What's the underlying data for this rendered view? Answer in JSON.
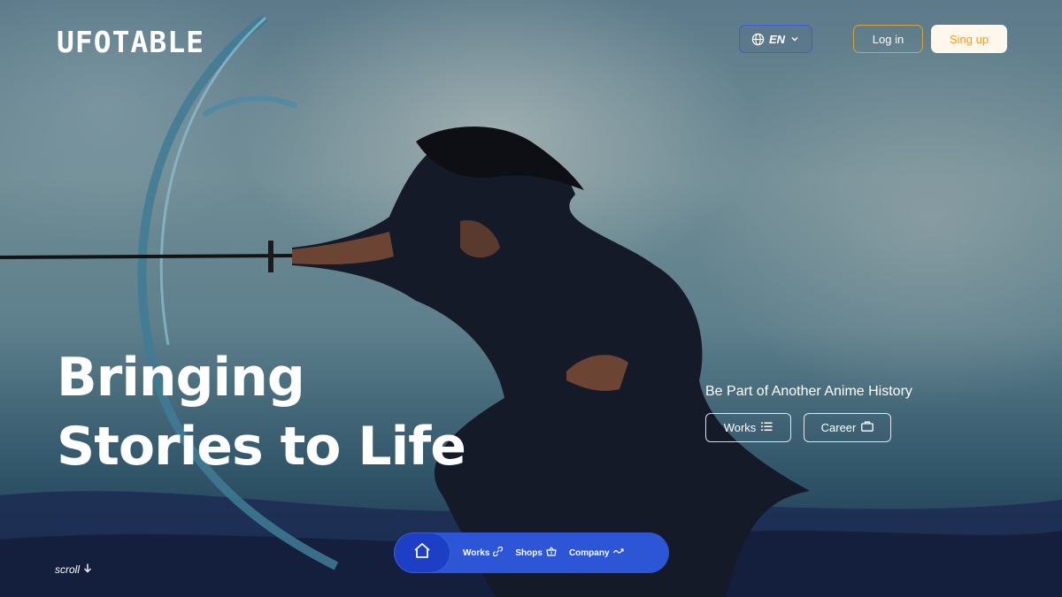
{
  "brand": {
    "logo": "UFOTABLE"
  },
  "header": {
    "language": "EN",
    "login_label": "Log in",
    "signup_label": "Sing up"
  },
  "hero": {
    "headline_line1": "Bringing",
    "headline_line2": "Stories to Life",
    "tagline": "Be Part of Another Anime History",
    "works_label": "Works",
    "career_label": "Career"
  },
  "scroll_label": "scroll",
  "bottom_nav": {
    "items": [
      {
        "label": "Works",
        "icon": "link-icon"
      },
      {
        "label": "Shops",
        "icon": "basket-icon"
      },
      {
        "label": "Company",
        "icon": "wave-icon"
      }
    ]
  },
  "colors": {
    "accent_blue": "#2d56d6",
    "signup_text": "#f29c1f",
    "login_border": "#d9a13a",
    "lang_border": "#3d5bd6"
  }
}
